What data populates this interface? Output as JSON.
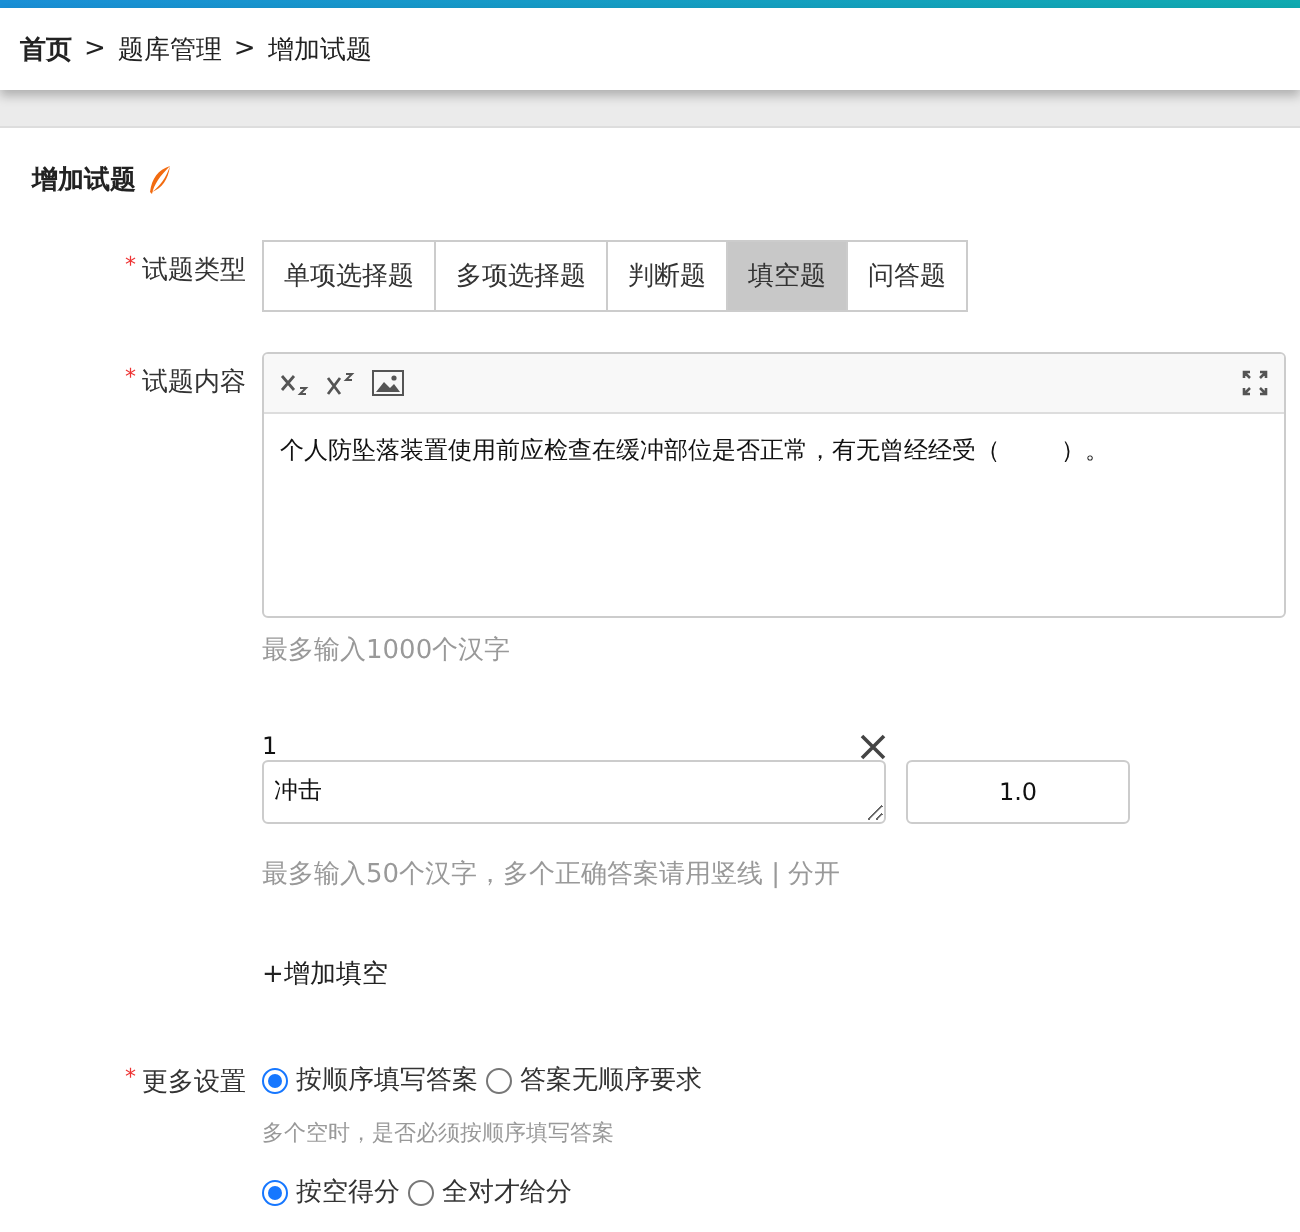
{
  "breadcrumb": [
    {
      "kind": "home",
      "label": "首页"
    },
    {
      "kind": "separator",
      "label": ">"
    },
    {
      "kind": "link",
      "label": "题库管理"
    },
    {
      "kind": "separator",
      "label": ">"
    },
    {
      "kind": "current",
      "label": "增加试题"
    }
  ],
  "title": "增加试题",
  "type_field": {
    "required_mark": "*",
    "label": "试题类型",
    "options": [
      {
        "label": "单项选择题",
        "selected": false
      },
      {
        "label": "多项选择题",
        "selected": false
      },
      {
        "label": "判断题",
        "selected": false
      },
      {
        "label": "填空题",
        "selected": true
      },
      {
        "label": "问答题",
        "selected": false
      }
    ]
  },
  "content_field": {
    "required_mark": "*",
    "label": "试题内容",
    "value": "个人防坠落装置使用前应检查在缓冲部位是否正常，有无曾经经受（        ）。",
    "hint": "最多输入1000个汉字"
  },
  "blanks": [
    {
      "number": "1",
      "answer": "冲击",
      "score": "1.0"
    }
  ],
  "blank_hint": "最多输入50个汉字，多个正确答案请用竖线 | 分开",
  "add_blank": "+增加填空",
  "more_settings": {
    "required_mark": "*",
    "label": "更多设置",
    "groups": [
      {
        "options": [
          {
            "label": "按顺序填写答案",
            "selected": true
          },
          {
            "label": "答案无顺序要求",
            "selected": false
          }
        ],
        "hint": "多个空时，是否必须按顺序填写答案"
      },
      {
        "options": [
          {
            "label": "按空得分",
            "selected": true
          },
          {
            "label": "全对才给分",
            "selected": false
          }
        ]
      }
    ]
  }
}
